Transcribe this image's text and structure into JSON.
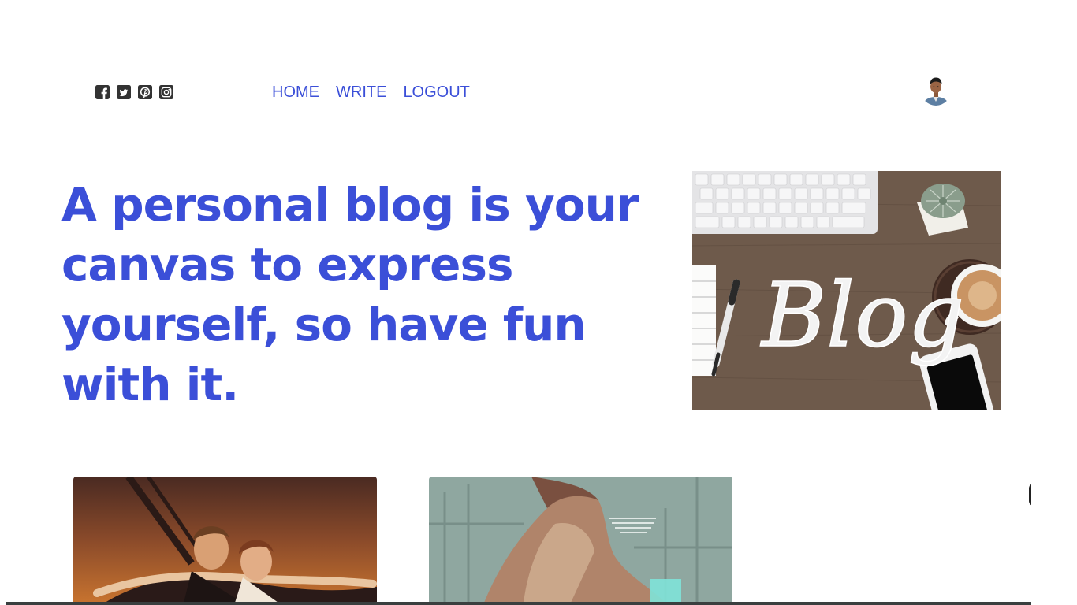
{
  "nav": {
    "social": [
      {
        "icon": "facebook-square-icon"
      },
      {
        "icon": "twitter-square-icon"
      },
      {
        "icon": "pinterest-square-icon"
      },
      {
        "icon": "instagram-square-icon"
      }
    ],
    "links": [
      {
        "label": "HOME"
      },
      {
        "label": "WRITE"
      },
      {
        "label": "LOGOUT"
      }
    ],
    "avatar_icon": "user-avatar"
  },
  "hero": {
    "title": "A personal blog is your canvas to express yourself, so have fun with it.",
    "image_word": "Blog"
  },
  "posts": [
    {
      "image": "titanic-couple-photo"
    },
    {
      "image": "illustrated-hooded-figure-photo"
    }
  ],
  "colors": {
    "accent": "#3b4fd8",
    "icon": "#333333",
    "desk": "#6e5a4b"
  }
}
